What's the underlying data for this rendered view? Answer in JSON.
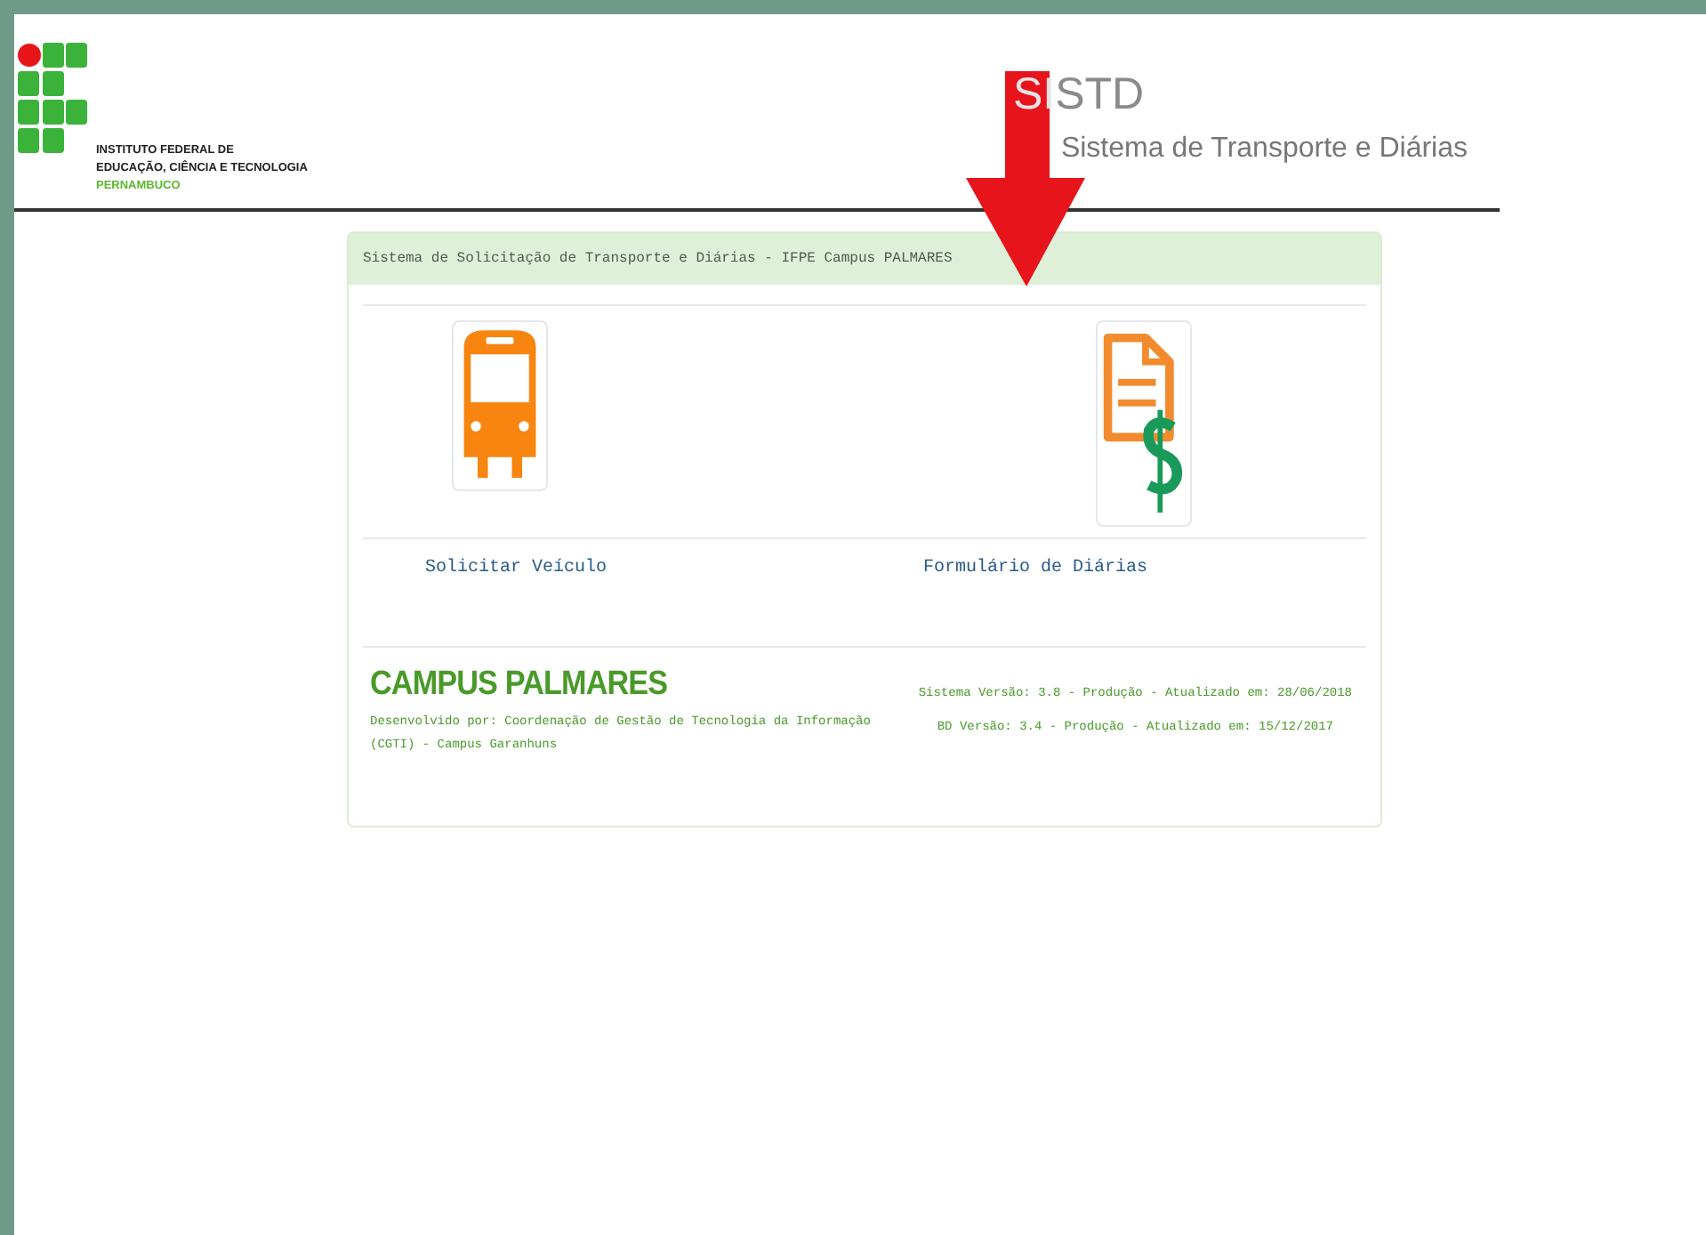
{
  "institute": {
    "lines": [
      "INSTITUTO FEDERAL DE",
      "EDUCAÇÃO, CIÊNCIA E TECNOLOGIA"
    ],
    "state": "PERNAMBUCO"
  },
  "system_logo": {
    "mark_highlight": "SI",
    "mark_rest": "STD",
    "subtitle": "Sistema de Transporte e Diárias"
  },
  "panel": {
    "title": "Sistema de Solicitação de Transporte e Diárias - IFPE Campus PALMARES",
    "options": [
      {
        "kind": "bus",
        "label": "Solicitar Veículo"
      },
      {
        "kind": "document",
        "label": "Formulário de Diárias"
      }
    ],
    "campus": "CAMPUS PALMARES",
    "developed_by": "Desenvolvido por: Coordenação de Gestão de Tecnologia da Informação (CGTI) - Campus Garanhuns",
    "versions": [
      "Sistema Versão: 3.8 - Produção - Atualizado em: 28/06/2018",
      "BD Versão: 3.4 - Produção - Atualizado em: 15/12/2017"
    ]
  }
}
